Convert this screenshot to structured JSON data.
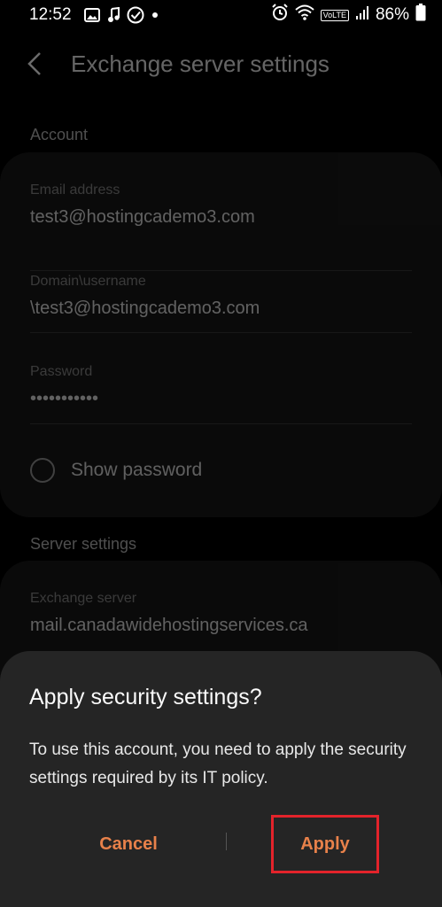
{
  "status_bar": {
    "time": "12:52",
    "battery": "86%",
    "network_badge": "VoLTE"
  },
  "header": {
    "title": "Exchange server settings"
  },
  "account": {
    "section_label": "Account",
    "email_label": "Email address",
    "email_value": "test3@hostingcademo3.com",
    "domain_label": "Domain\\username",
    "domain_value": "\\test3@hostingcademo3.com",
    "password_label": "Password",
    "password_value": "•••••••••••",
    "show_password_label": "Show password"
  },
  "server": {
    "section_label": "Server settings",
    "exchange_label": "Exchange server",
    "exchange_value": "mail.canadawidehostingservices.ca"
  },
  "dialog": {
    "title": "Apply security settings?",
    "body": "To use this account, you need to apply the security settings required by its IT policy.",
    "cancel_label": "Cancel",
    "apply_label": "Apply"
  },
  "colors": {
    "accent": "#e8814a",
    "highlight_box": "#e3232b",
    "dialog_bg": "#252525"
  }
}
